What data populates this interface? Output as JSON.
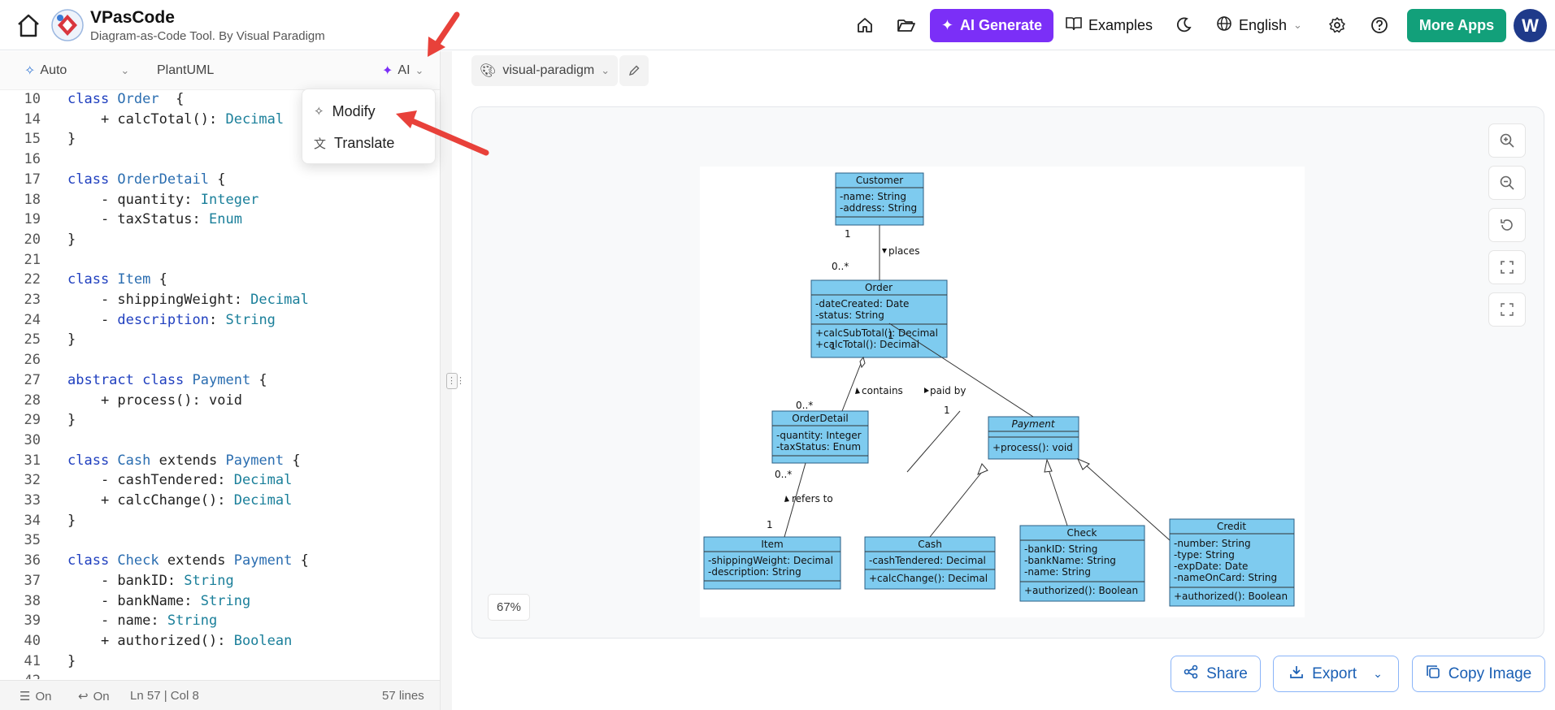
{
  "header": {
    "brand_title": "VPasCode",
    "brand_subtitle": "Diagram-as-Code Tool. By Visual Paradigm",
    "ai_generate_label": "AI Generate",
    "examples_label": "Examples",
    "language_label": "English",
    "more_apps_label": "More Apps",
    "avatar_letter": "W"
  },
  "editor_toolbar": {
    "mode": "Auto",
    "language": "PlantUML",
    "ai": "AI"
  },
  "ai_menu": {
    "items": [
      "Modify",
      "Translate"
    ]
  },
  "editor": {
    "lines": [
      {
        "n": "10",
        "parts": [
          [
            "kw",
            "class "
          ],
          [
            "cls",
            "Order"
          ],
          [
            "",
            "  {"
          ]
        ]
      },
      {
        "n": "14",
        "parts": [
          [
            "",
            "    + calcTotal(): "
          ],
          [
            "typ",
            "Decimal"
          ]
        ]
      },
      {
        "n": "15",
        "parts": [
          [
            "",
            "}"
          ]
        ]
      },
      {
        "n": "16",
        "parts": [
          [
            "",
            ""
          ]
        ]
      },
      {
        "n": "17",
        "parts": [
          [
            "kw",
            "class "
          ],
          [
            "cls",
            "OrderDetail"
          ],
          [
            "",
            " {"
          ]
        ]
      },
      {
        "n": "18",
        "parts": [
          [
            "",
            "    - quantity: "
          ],
          [
            "typ",
            "Integer"
          ]
        ]
      },
      {
        "n": "19",
        "parts": [
          [
            "",
            "    - taxStatus: "
          ],
          [
            "typ",
            "Enum"
          ]
        ]
      },
      {
        "n": "20",
        "parts": [
          [
            "",
            "}"
          ]
        ]
      },
      {
        "n": "21",
        "parts": [
          [
            "",
            ""
          ]
        ]
      },
      {
        "n": "22",
        "parts": [
          [
            "kw",
            "class "
          ],
          [
            "cls",
            "Item"
          ],
          [
            "",
            " {"
          ]
        ]
      },
      {
        "n": "23",
        "parts": [
          [
            "",
            "    - shippingWeight: "
          ],
          [
            "typ",
            "Decimal"
          ]
        ]
      },
      {
        "n": "24",
        "parts": [
          [
            "",
            "    - "
          ],
          [
            "kw",
            "description"
          ],
          [
            "",
            ": "
          ],
          [
            "typ",
            "String"
          ]
        ]
      },
      {
        "n": "25",
        "parts": [
          [
            "",
            "}"
          ]
        ]
      },
      {
        "n": "26",
        "parts": [
          [
            "",
            ""
          ]
        ]
      },
      {
        "n": "27",
        "parts": [
          [
            "kw",
            "abstract class "
          ],
          [
            "cls",
            "Payment"
          ],
          [
            "",
            " {"
          ]
        ]
      },
      {
        "n": "28",
        "parts": [
          [
            "",
            "    + process(): void"
          ]
        ]
      },
      {
        "n": "29",
        "parts": [
          [
            "",
            "}"
          ]
        ]
      },
      {
        "n": "30",
        "parts": [
          [
            "",
            ""
          ]
        ]
      },
      {
        "n": "31",
        "parts": [
          [
            "kw",
            "class "
          ],
          [
            "cls",
            "Cash"
          ],
          [
            "",
            " extends "
          ],
          [
            "cls",
            "Payment"
          ],
          [
            "",
            " {"
          ]
        ]
      },
      {
        "n": "32",
        "parts": [
          [
            "",
            "    - cashTendered: "
          ],
          [
            "typ",
            "Decimal"
          ]
        ]
      },
      {
        "n": "33",
        "parts": [
          [
            "",
            "    + calcChange(): "
          ],
          [
            "typ",
            "Decimal"
          ]
        ]
      },
      {
        "n": "34",
        "parts": [
          [
            "",
            "}"
          ]
        ]
      },
      {
        "n": "35",
        "parts": [
          [
            "",
            ""
          ]
        ]
      },
      {
        "n": "36",
        "parts": [
          [
            "kw",
            "class "
          ],
          [
            "cls",
            "Check"
          ],
          [
            "",
            " extends "
          ],
          [
            "cls",
            "Payment"
          ],
          [
            "",
            " {"
          ]
        ]
      },
      {
        "n": "37",
        "parts": [
          [
            "",
            "    - bankID: "
          ],
          [
            "typ",
            "String"
          ]
        ]
      },
      {
        "n": "38",
        "parts": [
          [
            "",
            "    - bankName: "
          ],
          [
            "typ",
            "String"
          ]
        ]
      },
      {
        "n": "39",
        "parts": [
          [
            "",
            "    - name: "
          ],
          [
            "typ",
            "String"
          ]
        ]
      },
      {
        "n": "40",
        "parts": [
          [
            "",
            "    + authorized(): "
          ],
          [
            "typ",
            "Boolean"
          ]
        ]
      },
      {
        "n": "41",
        "parts": [
          [
            "",
            "}"
          ]
        ]
      },
      {
        "n": "42",
        "parts": [
          [
            "",
            ""
          ]
        ]
      }
    ]
  },
  "status_bar": {
    "wrap": "On",
    "fold": "On",
    "cursor": "Ln 57 | Col 8",
    "lines": "57 lines"
  },
  "preview": {
    "theme": "visual-paradigm",
    "zoom": "67%",
    "share_label": "Share",
    "export_label": "Export",
    "copy_label": "Copy Image"
  },
  "uml": {
    "customer": {
      "name": "Customer",
      "attrs": [
        "-name: String",
        "-address: String"
      ]
    },
    "order": {
      "name": "Order",
      "attrs": [
        "-dateCreated: Date",
        "-status: String"
      ],
      "ops": [
        "+calcSubTotal(): Decimal",
        "+calcTotal(): Decimal"
      ]
    },
    "orderdetail": {
      "name": "OrderDetail",
      "attrs": [
        "-quantity: Integer",
        "-taxStatus: Enum"
      ]
    },
    "payment": {
      "name": "Payment",
      "ops": [
        "+process(): void"
      ]
    },
    "item": {
      "name": "Item",
      "attrs": [
        "-shippingWeight: Decimal",
        "-description: String"
      ]
    },
    "cash": {
      "name": "Cash",
      "attrs": [
        "-cashTendered: Decimal"
      ],
      "ops": [
        "+calcChange(): Decimal"
      ]
    },
    "check": {
      "name": "Check",
      "attrs": [
        "-bankID: String",
        "-bankName: String",
        "-name: String"
      ],
      "ops": [
        "+authorized(): Boolean"
      ]
    },
    "credit": {
      "name": "Credit",
      "attrs": [
        "-number: String",
        "-type: String",
        "-expDate: Date",
        "-nameOnCard: String"
      ],
      "ops": [
        "+authorized(): Boolean"
      ]
    },
    "labels": {
      "places": "places",
      "contains": "contains",
      "paid_by": "paid by",
      "refers_to": "refers to",
      "m_c1": "1",
      "m_o0": "0..*",
      "m_o1a": "1",
      "m_od0": "0..*",
      "m_o1b": "1",
      "m_p1": "1",
      "m_od0b": "0..*",
      "m_i1": "1"
    }
  }
}
